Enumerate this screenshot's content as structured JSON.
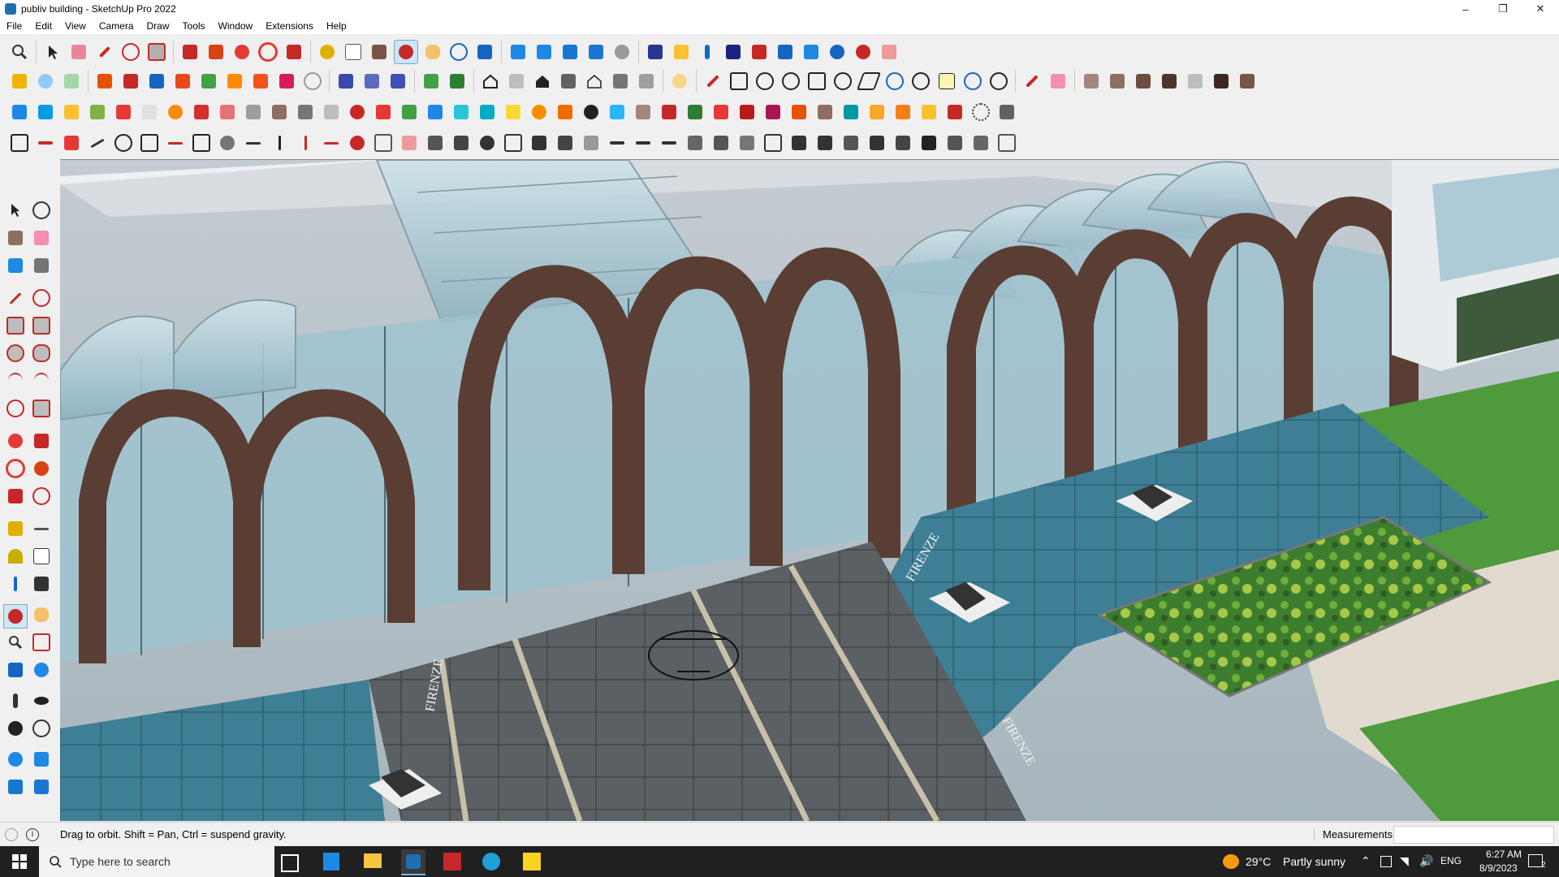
{
  "window": {
    "title": "publiv building - SketchUp Pro 2022",
    "minimize": "–",
    "maximize": "❐",
    "close": "✕"
  },
  "menu": [
    "File",
    "Edit",
    "View",
    "Camera",
    "Draw",
    "Tools",
    "Window",
    "Extensions",
    "Help"
  ],
  "status": {
    "hint": "Drag to orbit.  Shift = Pan, Ctrl = suspend gravity.",
    "measurements_label": "Measurements",
    "measurements_value": ""
  },
  "scene": {
    "sign_text": "FIRENZE"
  },
  "taskbar": {
    "search_placeholder": "Type here to search",
    "weather_temp": "29°C",
    "weather_desc": "Partly sunny",
    "language": "ENG",
    "time": "6:27 AM",
    "date": "8/9/2023",
    "notification_count": "2"
  },
  "colors": {
    "toolbar_bg": "#f0f0f0",
    "active_tool": "#cde6f7",
    "arch_brown": "#5a3e33",
    "glass": "#a9c8d4",
    "water": "#3f7f96",
    "paving": "#555a5e",
    "grass": "#4f9a3c"
  }
}
